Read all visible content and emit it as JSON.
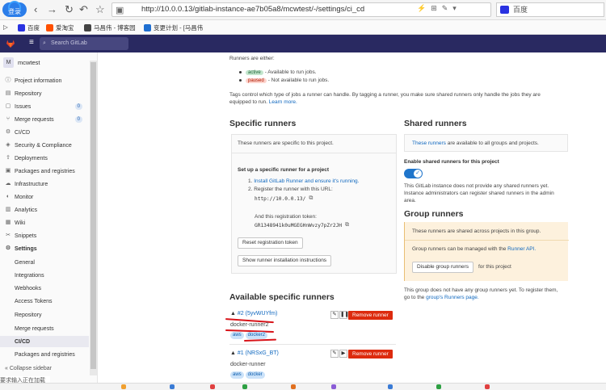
{
  "browser": {
    "login_badge": "登录",
    "url": "http://10.0.0.13/gitlab-instance-ae7b05a8/mcwtest/-/settings/ci_cd",
    "search_engine": "百度",
    "bookmarks": [
      "百度",
      "爱淘宝",
      "马昌伟 - 博客园",
      "变更计划 - [马昌伟"
    ]
  },
  "gitlab": {
    "brand": "GitLab",
    "search_placeholder": "Search GitLab"
  },
  "sidebar": {
    "avatar_letter": "M",
    "project_name": "mcwtest",
    "items": [
      {
        "label": "Project information",
        "icon": "info-icon"
      },
      {
        "label": "Repository",
        "icon": "book-icon"
      },
      {
        "label": "Issues",
        "icon": "issues-icon",
        "count": "0"
      },
      {
        "label": "Merge requests",
        "icon": "merge-request-icon",
        "count": "0"
      },
      {
        "label": "CI/CD",
        "icon": "rocket-icon"
      },
      {
        "label": "Security & Compliance",
        "icon": "shield-icon"
      },
      {
        "label": "Deployments",
        "icon": "deployments-icon"
      },
      {
        "label": "Packages and registries",
        "icon": "package-icon"
      },
      {
        "label": "Infrastructure",
        "icon": "cloud-icon"
      },
      {
        "label": "Monitor",
        "icon": "monitor-icon"
      },
      {
        "label": "Analytics",
        "icon": "chart-icon"
      },
      {
        "label": "Wiki",
        "icon": "wiki-icon"
      },
      {
        "label": "Snippets",
        "icon": "snippet-icon"
      },
      {
        "label": "Settings",
        "icon": "gear-icon"
      }
    ],
    "sub_items": [
      "General",
      "Integrations",
      "Webhooks",
      "Access Tokens",
      "Repository",
      "Merge requests",
      "CI/CD",
      "Packages and registries"
    ],
    "collapse_label": "Collapse sidebar",
    "status_text": "要求输入正在加载"
  },
  "main": {
    "runners_either": "Runners are either:",
    "active_pill": "active",
    "active_desc": "- Available to run jobs.",
    "paused_pill": "paused",
    "paused_desc": "- Not available to run jobs.",
    "tags_text_1": "Tags control which type of jobs a runner can handle. By tagging a runner, you make sure shared runners only handle the jobs they are",
    "tags_text_2": "equipped to run.",
    "learn_more": "Learn more.",
    "specific": {
      "title": "Specific runners",
      "note": "These runners are specific to this project.",
      "setup_title": "Set up a specific runner for a project",
      "step1": "Install GitLab Runner and ensure it's running.",
      "step2": "Register the runner with this URL:",
      "register_url": "http://10.0.0.13/",
      "token_label": "And this registration token:",
      "token": "GR1348941k0uMGEGHnWvzy7pZr2JH",
      "reset_button": "Reset registration token",
      "show_instructions_button": "Show runner installation instructions"
    },
    "shared": {
      "title": "Shared runners",
      "note_link": "These runners",
      "note_rest": "are available to all groups and projects.",
      "enable_label": "Enable shared runners for this project",
      "toggle_state": "on",
      "instance_note_1": "This GitLab instance does not provide any shared runners yet.",
      "instance_note_2": "Instance administrators can register shared runners in the admin",
      "instance_note_3": "area."
    },
    "group": {
      "title": "Group runners",
      "shared_note": "These runners are shared across projects in this group.",
      "manage_text": "Group runners can be managed with the",
      "manage_link": "Runner API.",
      "disable_button": "Disable group runners",
      "for_project": "for this project",
      "no_runner_1": "This group does not have any group runners yet. To register them,",
      "no_runner_2_prefix": "go to the",
      "no_runner_2_link": "group's Runners page."
    },
    "available": {
      "title": "Available specific runners",
      "remove_label": "Remove runner",
      "runners": [
        {
          "id": "#2 (5yvWUYfm)",
          "name": "docker-runner2",
          "tags": [
            "aws",
            "docker2"
          ],
          "state_button": "pause"
        },
        {
          "id": "#1 (NRSxG_BT)",
          "name": "docker-runner",
          "tags": [
            "aws",
            "docker"
          ],
          "state_button": "play"
        }
      ]
    }
  },
  "colors": {
    "header": "#292961",
    "remove": "#dd2b0e",
    "link": "#1068bf",
    "annotation": "#d8141a"
  }
}
